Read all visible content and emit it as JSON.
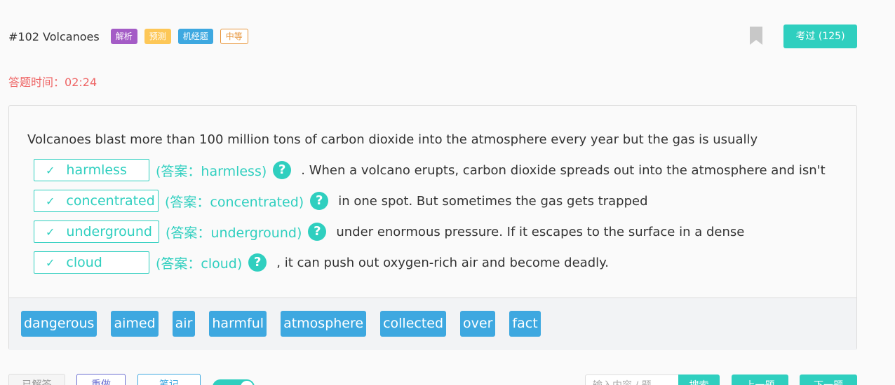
{
  "header": {
    "title": "#102 Volcanoes",
    "tags": [
      "解析",
      "预测",
      "机经题",
      "中等"
    ],
    "kaoguo_label": "考过 (125)"
  },
  "timer": {
    "label": "答题时间：",
    "value": "02:24"
  },
  "question": {
    "intro": "Volcanoes blast more than 100 million tons of carbon dioxide into the atmosphere every year but the gas is usually",
    "blanks": [
      {
        "value": "harmless",
        "answer": "(答案：harmless)",
        "rest": ". When a volcano erupts, carbon dioxide spreads out into the atmosphere and isn't"
      },
      {
        "value": "concentrated",
        "answer": "(答案：concentrated)",
        "rest": "in one spot. But sometimes the gas gets trapped"
      },
      {
        "value": "underground",
        "answer": "(答案：underground)",
        "rest": "under enormous pressure. If it escapes to the surface in a dense"
      },
      {
        "value": "cloud",
        "answer": "(答案：cloud)",
        "rest": ", it can push out oxygen-rich air and become deadly."
      }
    ],
    "check_mark": "✓",
    "help_mark": "?"
  },
  "word_bank": [
    "dangerous",
    "aimed",
    "air",
    "harmful",
    "atmosphere",
    "collected",
    "over",
    "fact"
  ],
  "footer": {
    "b1": "已解答",
    "b2": "重做",
    "b3": "笔记",
    "search_placeholder": "输入内容 / 题",
    "search_btn": "搜索",
    "prev": "上一题",
    "next": "下一题"
  },
  "colors": {
    "accent": "#2fcfbf",
    "chip": "#3ea8e0",
    "timer": "#ee6464"
  },
  "icons": {
    "bookmark": "bookmark-icon",
    "check": "check-icon",
    "help": "question-icon"
  }
}
